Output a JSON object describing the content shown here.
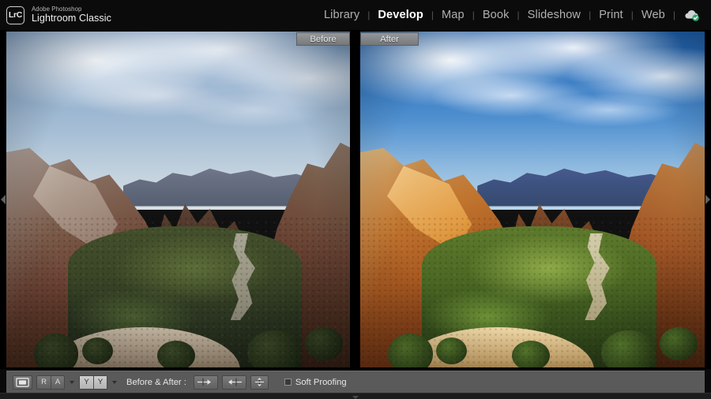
{
  "app": {
    "logo_text": "LrC",
    "brand_sub": "Adobe Photoshop",
    "brand_main": "Lightroom Classic"
  },
  "modules": {
    "items": [
      {
        "label": "Library",
        "active": false
      },
      {
        "label": "Develop",
        "active": true
      },
      {
        "label": "Map",
        "active": false
      },
      {
        "label": "Book",
        "active": false
      },
      {
        "label": "Slideshow",
        "active": false
      },
      {
        "label": "Print",
        "active": false
      },
      {
        "label": "Web",
        "active": false
      }
    ],
    "separator": "|",
    "sync_status_icon": "cloud-check-icon"
  },
  "viewer": {
    "mode": "before-after-side-by-side",
    "before_label": "Before",
    "after_label": "After",
    "left_panel_collapse_icon": "chevron-left-icon",
    "right_panel_collapse_icon": "chevron-right-icon",
    "image_subject": "Zion Canyon overlook"
  },
  "toolbar": {
    "loupe_view_icon": "loupe-view-icon",
    "reference_view": {
      "left": "R",
      "right": "A",
      "selected": false
    },
    "reference_caret_icon": "chevron-down-icon",
    "before_after_view": {
      "left": "Y",
      "right": "Y",
      "selected": true
    },
    "before_after_caret_icon": "chevron-down-icon",
    "before_after_label": "Before & After :",
    "copy_buttons": [
      {
        "name": "copy-before-settings-to-after",
        "icon": "arrow-right-icon",
        "glyph": "→"
      },
      {
        "name": "copy-after-settings-to-before",
        "icon": "arrow-left-icon",
        "glyph": "←"
      },
      {
        "name": "swap-before-and-after-settings",
        "icon": "swap-vertical-icon",
        "glyph": "⇅"
      }
    ],
    "soft_proofing": {
      "label": "Soft Proofing",
      "checked": false
    }
  },
  "colors": {
    "app_background": "#0a0a0a",
    "toolbar_background": "#5a5a5a",
    "active_module_text": "#ffffff",
    "inactive_module_text": "#b0b0b0",
    "sync_badge_green": "#2eaa6e"
  }
}
